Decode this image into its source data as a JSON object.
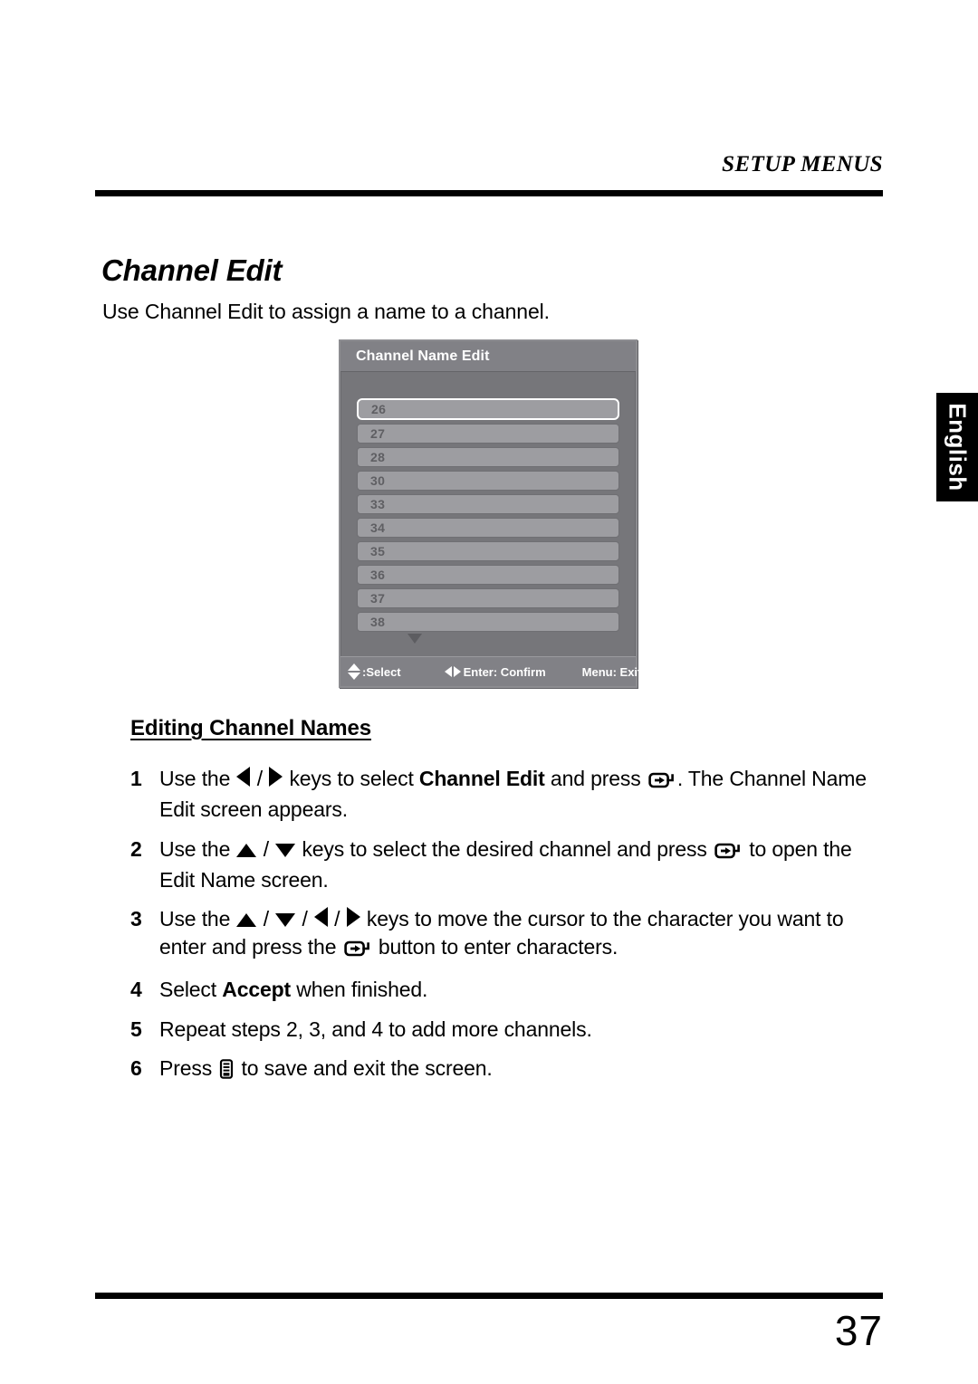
{
  "page": {
    "running_head": "SETUP MENUS",
    "number": "37",
    "language_tab": "English"
  },
  "section": {
    "title": "Channel Edit",
    "intro": "Use Channel Edit to assign a name to a channel.",
    "sub_heading": "Editing Channel Names"
  },
  "osd": {
    "title": "Channel Name Edit",
    "channels": [
      {
        "label": "26",
        "selected": true
      },
      {
        "label": "27",
        "selected": false
      },
      {
        "label": "28",
        "selected": false
      },
      {
        "label": "30",
        "selected": false
      },
      {
        "label": "33",
        "selected": false
      },
      {
        "label": "34",
        "selected": false
      },
      {
        "label": "35",
        "selected": false
      },
      {
        "label": "36",
        "selected": false
      },
      {
        "label": "37",
        "selected": false
      },
      {
        "label": "38",
        "selected": false
      }
    ],
    "scroll_indicator": "down-triangle-icon",
    "footer": {
      "select": ":Select",
      "confirm": "Enter: Confirm",
      "exit": "Menu: Exit"
    }
  },
  "steps": [
    {
      "num": "1",
      "parts": [
        {
          "type": "text",
          "value": "Use the "
        },
        {
          "type": "icon",
          "value": "arrow-left-icon"
        },
        {
          "type": "text",
          "value": " / "
        },
        {
          "type": "icon",
          "value": "arrow-right-icon"
        },
        {
          "type": "text",
          "value": " keys to select "
        },
        {
          "type": "bold",
          "value": "Channel Edit"
        },
        {
          "type": "text",
          "value": " and press "
        },
        {
          "type": "icon",
          "value": "enter-key-icon"
        },
        {
          "type": "text",
          "value": ". The Channel Name Edit screen appears."
        }
      ]
    },
    {
      "num": "2",
      "parts": [
        {
          "type": "text",
          "value": "Use the "
        },
        {
          "type": "icon",
          "value": "arrow-up-icon"
        },
        {
          "type": "text",
          "value": " / "
        },
        {
          "type": "icon",
          "value": "arrow-down-icon"
        },
        {
          "type": "text",
          "value": " keys to select the desired channel and press "
        },
        {
          "type": "icon",
          "value": "enter-key-icon"
        },
        {
          "type": "text",
          "value": " to open the Edit Name screen."
        }
      ]
    },
    {
      "num": "3",
      "parts": [
        {
          "type": "text",
          "value": "Use the "
        },
        {
          "type": "icon",
          "value": "arrow-up-icon"
        },
        {
          "type": "text",
          "value": " / "
        },
        {
          "type": "icon",
          "value": "arrow-down-icon"
        },
        {
          "type": "text",
          "value": " / "
        },
        {
          "type": "icon",
          "value": "arrow-left-icon"
        },
        {
          "type": "text",
          "value": " / "
        },
        {
          "type": "icon",
          "value": "arrow-right-icon"
        },
        {
          "type": "text",
          "value": " keys to move the cursor to the character you want to enter and press the "
        },
        {
          "type": "icon",
          "value": "enter-key-icon"
        },
        {
          "type": "text",
          "value": " button to enter characters."
        }
      ]
    },
    {
      "num": "4",
      "parts": [
        {
          "type": "text",
          "value": "Select "
        },
        {
          "type": "bold",
          "value": "Accept"
        },
        {
          "type": "text",
          "value": " when finished."
        }
      ]
    },
    {
      "num": "5",
      "parts": [
        {
          "type": "text",
          "value": "Repeat steps 2, 3, and 4 to add more channels."
        }
      ]
    },
    {
      "num": "6",
      "parts": [
        {
          "type": "text",
          "value": "Press "
        },
        {
          "type": "icon",
          "value": "menu-button-icon"
        },
        {
          "type": "text",
          "value": " to save and exit the screen."
        }
      ]
    }
  ]
}
